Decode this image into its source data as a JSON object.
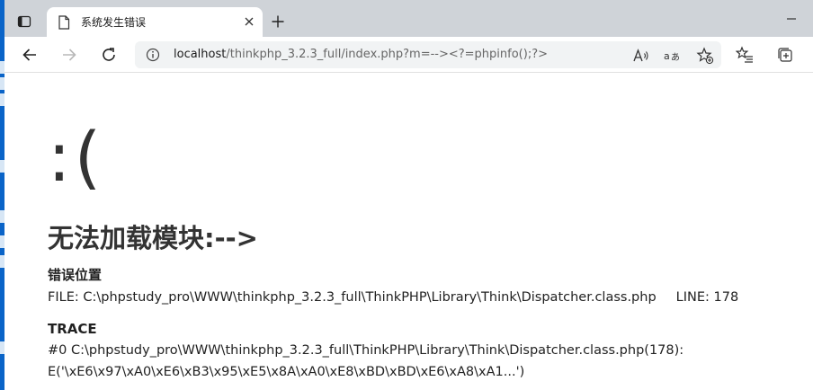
{
  "browser": {
    "tab": {
      "title": "系统发生错误"
    },
    "address": {
      "host": "localhost",
      "path": "/thinkphp_3.2.3_full/index.php?m=--><?=phpinfo();?>"
    }
  },
  "page": {
    "face": ":(",
    "error_title": "无法加载模块:-->",
    "location": {
      "heading": "错误位置",
      "file": "FILE: C:\\phpstudy_pro\\WWW\\thinkphp_3.2.3_full\\ThinkPHP\\Library\\Think\\Dispatcher.class.php",
      "line": "LINE: 178"
    },
    "trace": {
      "heading": "TRACE",
      "lines": [
        "#0 C:\\phpstudy_pro\\WWW\\thinkphp_3.2.3_full\\ThinkPHP\\Library\\Think\\Dispatcher.class.php(178):",
        "E('\\xE6\\x97\\xA0\\xE6\\xB3\\x95\\xE5\\x8A\\xA0\\xE8\\xBD\\xBD\\xE6\\xA8\\xA1...')"
      ]
    }
  }
}
